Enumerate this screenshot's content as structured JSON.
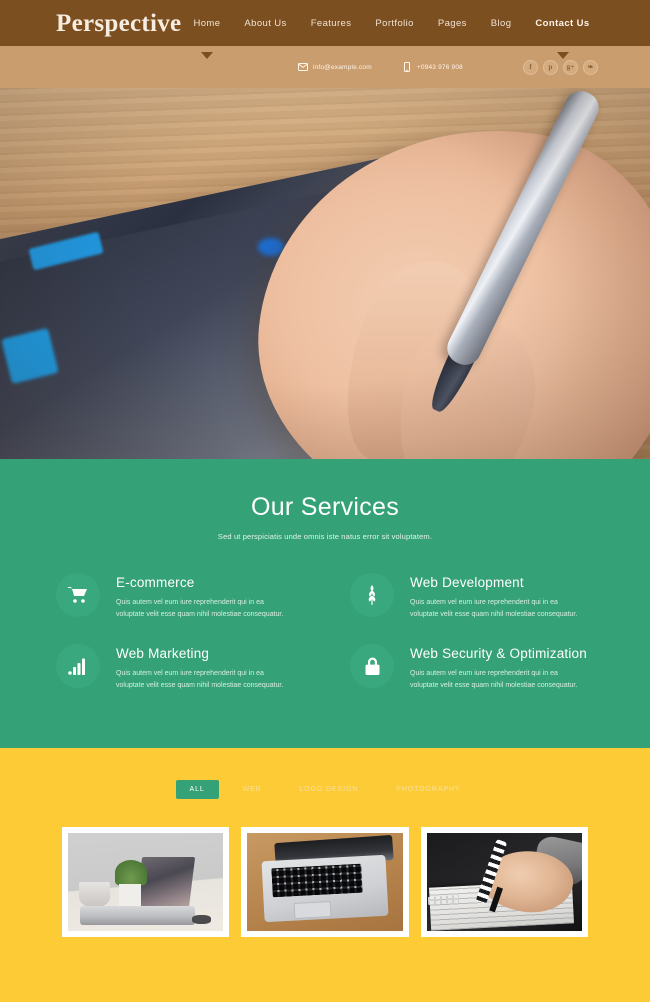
{
  "header": {
    "logo": "Perspective",
    "nav": [
      {
        "label": "Home",
        "active": true
      },
      {
        "label": "About Us",
        "active": false
      },
      {
        "label": "Features",
        "active": false
      },
      {
        "label": "Portfolio",
        "active": false
      },
      {
        "label": "Pages",
        "active": false
      },
      {
        "label": "Blog",
        "active": false
      },
      {
        "label": "Contact Us",
        "active": true
      }
    ],
    "colors": {
      "bar": "#7c4f21",
      "contact_bar": "#c99d6e",
      "logo_text": "#f6ecdf"
    }
  },
  "contact_bar": {
    "email": "info@example.com",
    "email_icon": "envelope-icon",
    "phone": "+0943 976 908",
    "phone_icon": "mobile-phone-icon",
    "socials": [
      {
        "name": "facebook",
        "glyph": "f"
      },
      {
        "name": "pinterest",
        "glyph": "p"
      },
      {
        "name": "google-plus",
        "glyph": "g+"
      },
      {
        "name": "twitter",
        "glyph": "❧"
      }
    ]
  },
  "hero": {
    "image_description": "Hand holding a silver pen writing on a graphics tablet on a wooden desk"
  },
  "services": {
    "title": "Our Services",
    "subtitle": "Sed ut perspiciatis unde omnis iste natus error sit voluptatem.",
    "background": "#35a177",
    "items": [
      {
        "title": "E-commerce",
        "icon": "shopping-cart-icon",
        "text": "Quis autem vel eum iure reprehenderit qui in ea voluptate velit esse quam nihil molestiae consequatur."
      },
      {
        "title": "Web Development",
        "icon": "leaf-icon",
        "text": "Quis autem vel eum iure reprehenderit qui in ea voluptate velit esse quam nihil molestiae consequatur."
      },
      {
        "title": "Web Marketing",
        "icon": "bar-chart-icon",
        "text": "Quis autem vel eum iure reprehenderit qui in ea voluptate velit esse quam nihil molestiae consequatur."
      },
      {
        "title": "Web Security & Optimization",
        "icon": "lock-icon",
        "text": "Quis autem vel eum iure reprehenderit qui in ea voluptate velit esse quam nihil molestiae consequatur."
      }
    ]
  },
  "portfolio": {
    "background": "#fdcb36",
    "filters": [
      {
        "label": "ALL",
        "active": true
      },
      {
        "label": "WEB",
        "active": false
      },
      {
        "label": "LOGO DESIGN",
        "active": false
      },
      {
        "label": "PHOTOGRAPHY",
        "active": false
      }
    ],
    "active_filter_color": "#35a177",
    "items": [
      {
        "alt": "Laptop with coffee cup and small plant on a desk"
      },
      {
        "alt": "Open laptop seen from above on a wooden table"
      },
      {
        "alt": "Hand writing with a pen on a notebook"
      }
    ]
  }
}
